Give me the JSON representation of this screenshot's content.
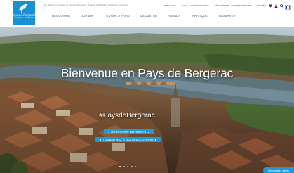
{
  "header": {
    "logo": {
      "line1": "Pays de Bergerac",
      "line2": "Dordogne - Périgord"
    },
    "tagline": "Site officiel du tourisme en Pays de Bergerac · Vignoble et Bastides · Dordogne · Périgord",
    "main_nav": [
      "DÉCOUVRIR",
      "DORMIR",
      "À VOIR, À FAIRE",
      "DÉGUSTER",
      "AGENDA",
      "PRATIQUE",
      "RÉSERVER"
    ],
    "util_nav": [
      "BONS PLANS",
      "BLOG",
      "CARTE INTERACTIVE",
      "DÉPARTEMENTS · TOURISME D'AFFAIRES",
      "GROUPES"
    ],
    "util_icons": [
      "heart-icon",
      "user-icon",
      "search-icon"
    ],
    "accent_color": "#1a9ad6"
  },
  "hero": {
    "title": "Bienvenue en Pays de Bergerac",
    "hashtag": "#PaysdeBergerac",
    "cta_primary": "DÉCOUVRIR BERGERAC",
    "cta_secondary": "TOMBER NEZ À NEZ AVEC CYRANO",
    "slides_count": 5,
    "active_slide": 1,
    "quote_button": "Demandez devis"
  }
}
